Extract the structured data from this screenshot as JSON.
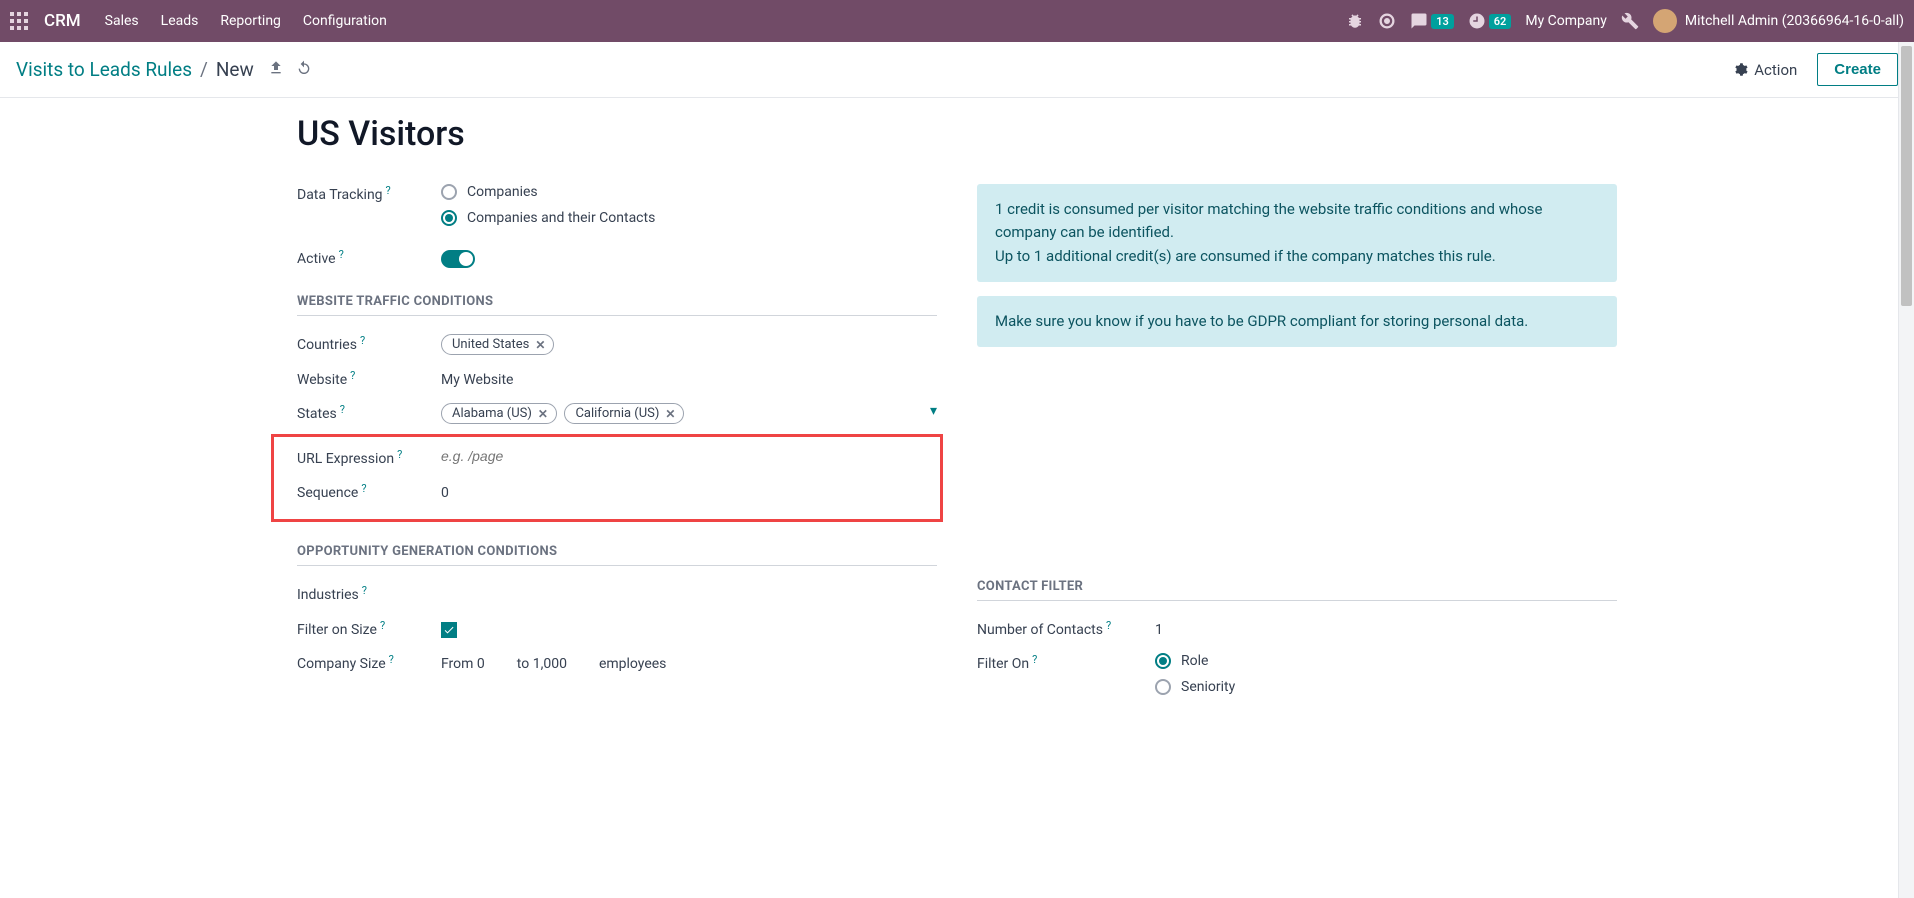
{
  "nav": {
    "brand": "CRM",
    "menu": [
      "Sales",
      "Leads",
      "Reporting",
      "Configuration"
    ],
    "msg_badge": "13",
    "clock_badge": "62",
    "company": "My Company",
    "user": "Mitchell Admin (20366964-16-0-all)"
  },
  "secbar": {
    "bc_link": "Visits to Leads Rules",
    "bc_current": "New",
    "action": "Action",
    "create": "Create"
  },
  "page": {
    "title": "US Visitors"
  },
  "left": {
    "data_tracking_label": "Data Tracking",
    "opt_companies": "Companies",
    "opt_companies_contacts": "Companies and their Contacts",
    "active_label": "Active",
    "section_traffic": "WEBSITE TRAFFIC CONDITIONS",
    "countries_label": "Countries",
    "country_tag": "United States",
    "website_label": "Website",
    "website_value": "My Website",
    "states_label": "States",
    "state_tag1": "Alabama (US)",
    "state_tag2": "California (US)",
    "url_label": "URL Expression",
    "url_placeholder": "e.g. /page",
    "seq_label": "Sequence",
    "seq_value": "0",
    "section_opp": "OPPORTUNITY GENERATION CONDITIONS",
    "industries_label": "Industries",
    "filter_size_label": "Filter on Size",
    "company_size_label": "Company Size",
    "from_label": "From",
    "from_value": "0",
    "to_label": "to",
    "to_value": "1,000",
    "employees_label": "employees"
  },
  "right": {
    "alert1": "1 credit is consumed per visitor matching the website traffic conditions and whose company can be identified.\nUp to 1 additional credit(s) are consumed if the company matches this rule.",
    "alert2": "Make sure you know if you have to be GDPR compliant for storing personal data.",
    "section_contact": "CONTACT FILTER",
    "num_contacts_label": "Number of Contacts",
    "num_contacts_value": "1",
    "filter_on_label": "Filter On",
    "opt_role": "Role",
    "opt_seniority": "Seniority"
  }
}
